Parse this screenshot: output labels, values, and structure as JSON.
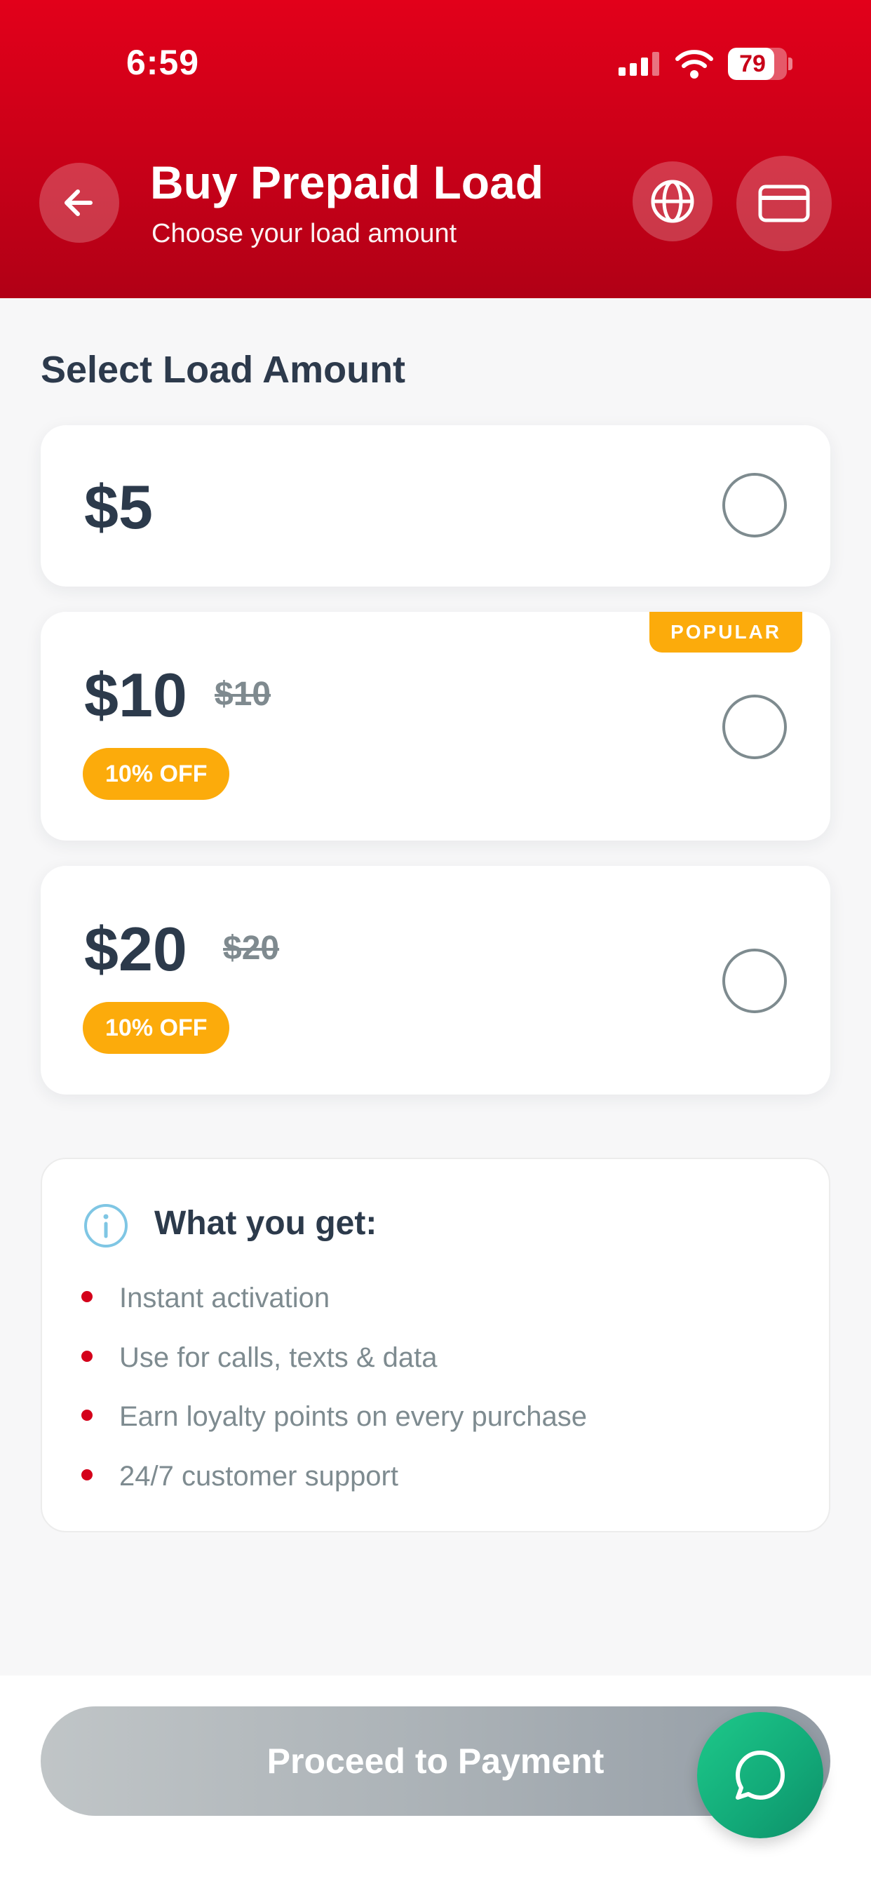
{
  "status_bar": {
    "time": "6:59",
    "battery": "79",
    "battery_level": 0.79
  },
  "header": {
    "title": "Buy Prepaid Load",
    "subtitle": "Choose your load amount",
    "icons": {
      "back": "arrow-left-icon",
      "language": "globe-icon",
      "payment": "credit-card-icon"
    }
  },
  "colors": {
    "brand_red": "#e2001a",
    "discount_orange": "#fcab0b",
    "chat_green": "#14b57f",
    "text_dark": "#2c3a4b",
    "text_muted": "#7e8b90"
  },
  "select_section": {
    "title": "Select Load Amount",
    "options": [
      {
        "price": "$5",
        "original_price": "",
        "discount": "",
        "badge": ""
      },
      {
        "price": "$10",
        "original_price": "$10",
        "discount": "10% OFF",
        "badge": "POPULAR"
      },
      {
        "price": "$20",
        "original_price": "$20",
        "discount": "10% OFF",
        "badge": ""
      }
    ]
  },
  "info": {
    "title": "What you get:",
    "benefits": [
      "Instant activation",
      "Use for calls, texts & data",
      "Earn loyalty points on every purchase",
      "24/7 customer support"
    ]
  },
  "footer": {
    "proceed_label": "Proceed to Payment",
    "chat_icon": "chat-bubble-icon"
  }
}
